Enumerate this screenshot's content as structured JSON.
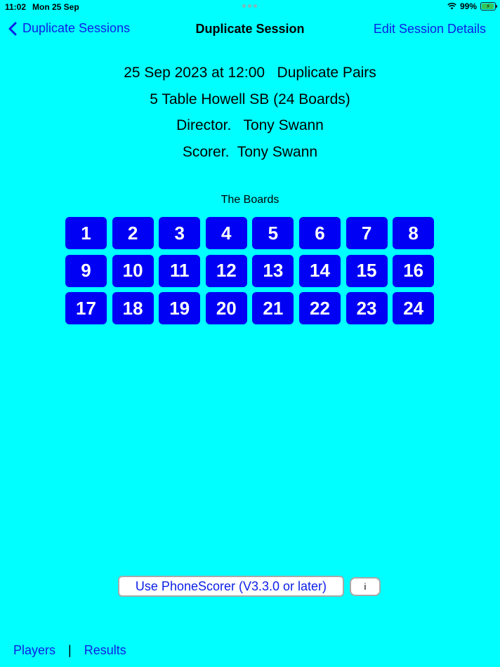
{
  "status_bar": {
    "time": "11:02",
    "date": "Mon 25 Sep",
    "battery": "99%"
  },
  "nav": {
    "back_label": "Duplicate Sessions",
    "title": "Duplicate Session",
    "edit_label": "Edit Session Details"
  },
  "session": {
    "line1": "25 Sep 2023 at 12:00   Duplicate Pairs",
    "line2": "5 Table Howell SB (24 Boards)",
    "line3": "Director.   Tony Swann",
    "line4": "Scorer.  Tony Swann"
  },
  "boards": {
    "heading": "The Boards",
    "items": [
      "1",
      "2",
      "3",
      "4",
      "5",
      "6",
      "7",
      "8",
      "9",
      "10",
      "11",
      "12",
      "13",
      "14",
      "15",
      "16",
      "17",
      "18",
      "19",
      "20",
      "21",
      "22",
      "23",
      "24"
    ]
  },
  "actions": {
    "phonescorer_label": "Use PhoneScorer (V3.3.0 or later)",
    "info_label": "i"
  },
  "footer": {
    "players_label": "Players",
    "separator": "|",
    "results_label": "Results"
  },
  "colors": {
    "background": "#00FFFF",
    "accent": "#0b1ee6",
    "board_button": "#0000F5"
  }
}
